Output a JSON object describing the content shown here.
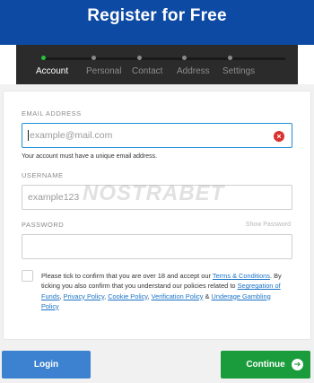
{
  "header": {
    "title": "Register for Free"
  },
  "steps": [
    {
      "label": "Account",
      "active": true
    },
    {
      "label": "Personal",
      "active": false
    },
    {
      "label": "Contact",
      "active": false
    },
    {
      "label": "Address",
      "active": false
    },
    {
      "label": "Settings",
      "active": false
    }
  ],
  "form": {
    "email": {
      "label": "EMAIL ADDRESS",
      "placeholder": "example@mail.com",
      "value": "",
      "hint": "Your account must have a unique email address."
    },
    "username": {
      "label": "USERNAME",
      "placeholder": "example123",
      "value": ""
    },
    "password": {
      "label": "PASSWORD",
      "placeholder": "",
      "value": "",
      "show_label": "Show Password"
    },
    "terms": {
      "text1": "Please tick to confirm that you are over 18 and accept our ",
      "link_terms": "Terms & Conditions",
      "text2": ". By ticking you also confirm that you understand our policies related to ",
      "link_segregation": "Segregation of Funds",
      "sep1": ", ",
      "link_privacy": "Privacy Policy",
      "sep2": ", ",
      "link_cookie": "Cookie Policy",
      "sep3": ", ",
      "link_verification": "Verification Policy",
      "sep4": " & ",
      "link_underage": "Underage Gambling Policy",
      "checked": false
    }
  },
  "watermark": "NOSTRABET",
  "buttons": {
    "login": "Login",
    "continue": "Continue"
  },
  "colors": {
    "header_bg": "#0d4aa3",
    "active_step": "#27c23a",
    "login_bg": "#3d82d1",
    "continue_bg": "#1a9c3c",
    "error": "#d8312f"
  },
  "icons": {
    "clear": "close-circle-icon",
    "continue": "arrow-right-circle-icon"
  }
}
